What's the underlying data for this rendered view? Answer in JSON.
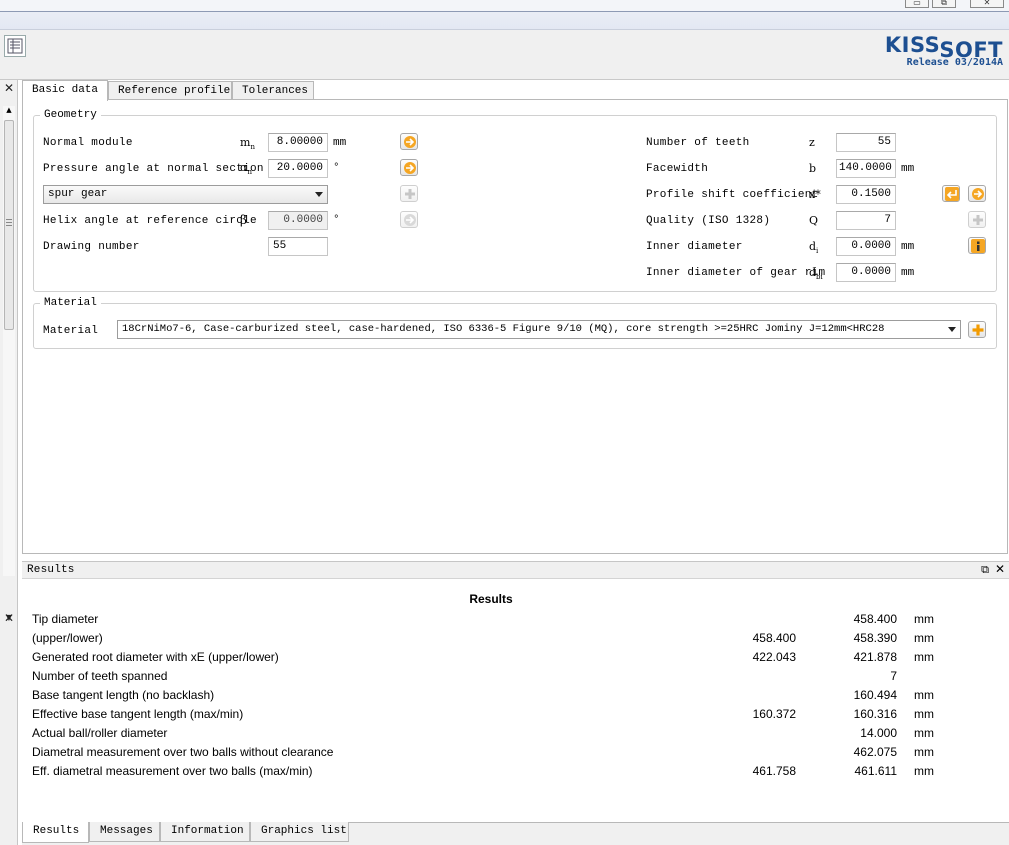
{
  "logo": {
    "text_kiss": "KISS",
    "text_soft": "SOFT",
    "release": "Release 03/2014A"
  },
  "tabs": [
    "Basic data",
    "Reference profile",
    "Tolerances"
  ],
  "geometry": {
    "legend": "Geometry",
    "normal_module": {
      "label": "Normal module",
      "symbol": "m",
      "sub": "n",
      "value": "8.00000",
      "unit": "mm"
    },
    "pressure_angle": {
      "label": "Pressure angle at normal section",
      "symbol": "α",
      "sub": "n",
      "value": "20.0000",
      "unit": "°"
    },
    "gear_type": "spur gear",
    "helix_angle": {
      "label": "Helix angle at reference circle",
      "symbol": "β",
      "value": "0.0000",
      "unit": "°"
    },
    "drawing_number": {
      "label": "Drawing number",
      "value": "55"
    },
    "teeth": {
      "label": "Number of teeth",
      "symbol": "z",
      "value": "55"
    },
    "facewidth": {
      "label": "Facewidth",
      "symbol": "b",
      "value": "140.0000",
      "unit": "mm"
    },
    "profile_shift": {
      "label": "Profile shift coefficient",
      "symbol": "x*",
      "value": "0.1500"
    },
    "quality": {
      "label": "Quality (ISO 1328)",
      "symbol": "Q",
      "value": "7"
    },
    "inner_diameter": {
      "label": "Inner diameter",
      "symbol": "d",
      "sub": "i",
      "value": "0.0000",
      "unit": "mm"
    },
    "inner_rim": {
      "label": "Inner diameter of gear rim",
      "symbol": "d",
      "sub": "bi",
      "value": "0.0000",
      "unit": "mm"
    }
  },
  "material": {
    "legend": "Material",
    "label": "Material",
    "value": "18CrNiMo7-6, Case-carburized steel, case-hardened, ISO 6336-5 Figure 9/10 (MQ), core strength >=25HRC Jominy J=12mm<HRC28"
  },
  "results": {
    "panel_title": "Results",
    "heading": "Results",
    "rows": [
      {
        "label": "Tip diameter",
        "v1": "",
        "v2": "458.400",
        "unit": "mm"
      },
      {
        "label": "(upper/lower)",
        "v1": "458.400",
        "v2": "458.390",
        "unit": "mm"
      },
      {
        "label": "Generated root diameter with xE (upper/lower)",
        "v1": "422.043",
        "v2": "421.878",
        "unit": "mm"
      },
      {
        "label": "Number of teeth spanned",
        "v1": "",
        "v2": "7",
        "unit": ""
      },
      {
        "label": "Base tangent length (no backlash)",
        "v1": "",
        "v2": "160.494",
        "unit": "mm"
      },
      {
        "label": "Effective base tangent length (max/min)",
        "v1": "160.372",
        "v2": "160.316",
        "unit": "mm"
      },
      {
        "label": "Actual ball/roller diameter",
        "v1": "",
        "v2": "14.000",
        "unit": "mm"
      },
      {
        "label": "Diametral measurement over two balls without clearance",
        "v1": "",
        "v2": "462.075",
        "unit": "mm"
      },
      {
        "label": "Eff. diametral measurement over two balls (max/min)",
        "v1": "461.758",
        "v2": "461.611",
        "unit": "mm"
      }
    ]
  },
  "bottom_tabs": [
    "Results",
    "Messages",
    "Information",
    "Graphics list"
  ]
}
